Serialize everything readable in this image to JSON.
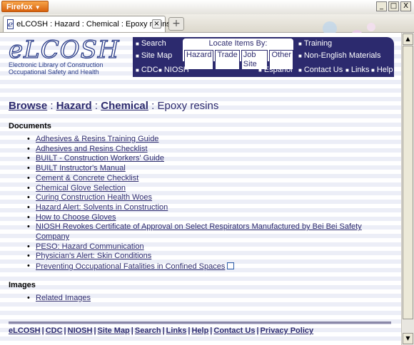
{
  "browser": {
    "menu_button": "Firefox",
    "minimize": "_",
    "maximize": "□",
    "close": "X",
    "new_tab": "+"
  },
  "tab": {
    "title": "eLCOSH : Hazard : Chemical : Epoxy resins",
    "icon_letter": "e"
  },
  "logo": {
    "big": "eLCOSH",
    "line1": "Electronic Library of Construction",
    "line2": "Occupational Safety and Health"
  },
  "nav": {
    "search": "Search",
    "sitemap": "Site Map",
    "training": "Training",
    "nonenglish": "Non-English Materials",
    "locate_title": "Locate Items By:",
    "locate_options": [
      "Hazard",
      "Trade",
      "Job Site",
      "Other"
    ],
    "cdc": "CDC",
    "niosh": "NIOSH",
    "espanol": "Español",
    "contact": "Contact Us",
    "links": "Links",
    "help": "Help"
  },
  "breadcrumb": {
    "browse": "Browse",
    "sep": ":",
    "hazard": "Hazard",
    "chemical": "Chemical",
    "current": "Epoxy resins"
  },
  "documents": {
    "heading": "Documents",
    "items": [
      "Adhesives & Resins Training Guide",
      "Adhesives and Resins Checklist",
      "BUILT - Construction Workers' Guide",
      "BUILT Instructor's Manual",
      "Cement & Concrete Checklist",
      "Chemical Glove Selection",
      "Curing Construction Health Woes",
      "Hazard Alert: Solvents in Construction",
      "How to Choose Gloves",
      "NIOSH Revokes Certificate of Approval on Select Respirators Manufactured by Bei Bei Safety Company",
      "PESO: Hazard Communication",
      "Physician's Alert: Skin Conditions",
      "Preventing Occupational Fatalities in Confined Spaces"
    ]
  },
  "images": {
    "heading": "Images",
    "items": [
      "Related Images"
    ]
  },
  "footer": {
    "links": [
      "eLCOSH",
      "CDC",
      "NIOSH",
      "Site Map",
      "Search",
      "Links",
      "Help",
      "Contact Us",
      "Privacy Policy"
    ],
    "separator": "|"
  },
  "colors": {
    "navy": "#2c2a6e",
    "firefox_orange": "#e07a1e"
  }
}
